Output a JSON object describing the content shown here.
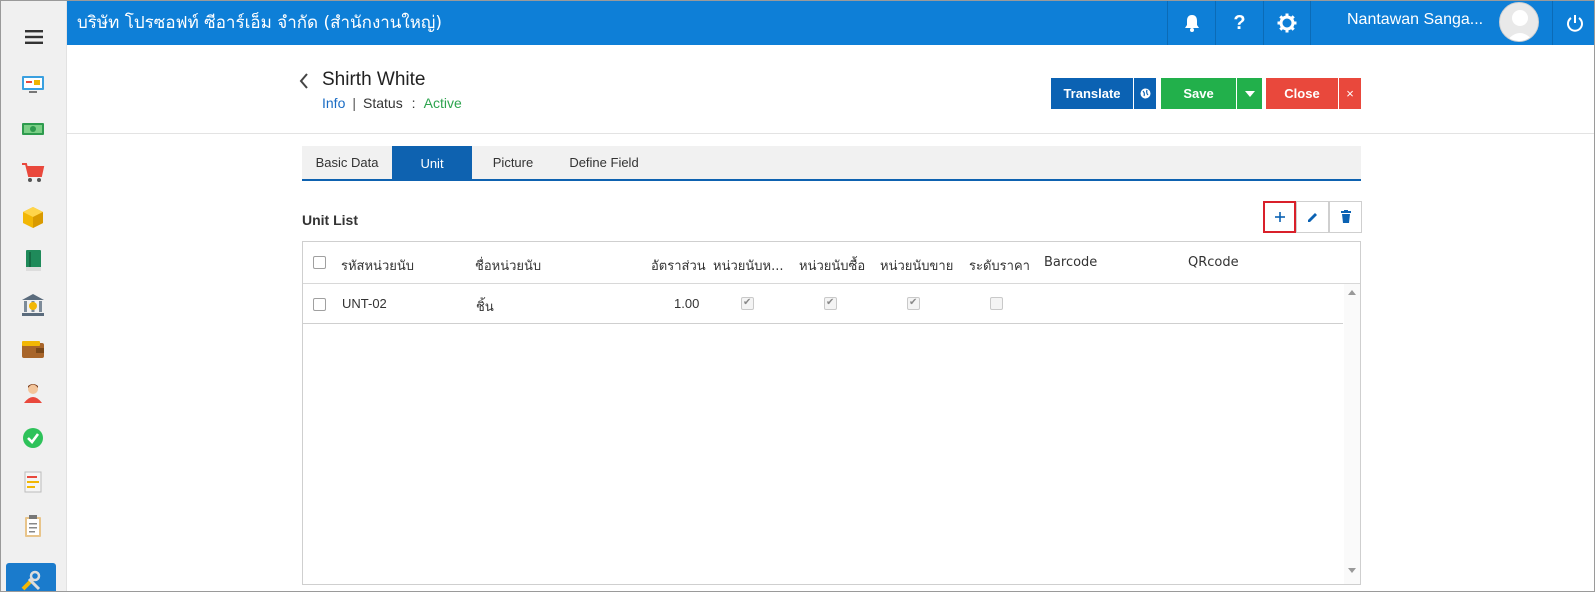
{
  "topbar": {
    "company": "บริษัท โปรซอฟท์ ซีอาร์เอ็ม จำกัด (สำนักงานใหญ่)",
    "user_name": "Nantawan Sanga...",
    "icons": [
      "bell-icon",
      "help-icon",
      "gear-icon",
      "avatar",
      "power-icon"
    ]
  },
  "sidebar": {
    "items": [
      "dashboard-icon",
      "money-icon",
      "cart-icon",
      "box-icon",
      "book-icon",
      "bank-icon",
      "wallet-icon",
      "person-icon",
      "check-icon",
      "transfer-icon",
      "clipboard-icon",
      "tools-icon"
    ]
  },
  "header": {
    "title": "Shirth White",
    "info_link": "Info",
    "separator": "|",
    "status_label": "Status",
    "status_colon": ":",
    "status_value": "Active"
  },
  "actions": {
    "translate": "Translate",
    "save": "Save",
    "close": "Close",
    "close_x": "×"
  },
  "tabs": [
    {
      "label": "Basic Data",
      "active": false
    },
    {
      "label": "Unit",
      "active": true
    },
    {
      "label": "Picture",
      "active": false
    },
    {
      "label": "Define Field",
      "active": false
    }
  ],
  "unit_list": {
    "title": "Unit List",
    "columns": [
      "รหัสหน่วยนับ",
      "ชื่อหน่วยนับ",
      "อัตราส่วน",
      "หน่วยนับห...",
      "หน่วยนับซื้อ",
      "หน่วยนับขาย",
      "ระดับราคา",
      "Barcode",
      "QRcode"
    ],
    "rows": [
      {
        "code": "UNT-02",
        "name": "ชิ้น",
        "ratio": "1.00",
        "main_unit": true,
        "buy_unit": true,
        "sell_unit": true,
        "price_level": false,
        "barcode": "",
        "qrcode": ""
      }
    ]
  },
  "colors": {
    "topbar": "#0e7fd7",
    "primary": "#0b62b3",
    "save": "#22b04b",
    "close": "#e9483c",
    "active_status": "#2ea44f"
  }
}
